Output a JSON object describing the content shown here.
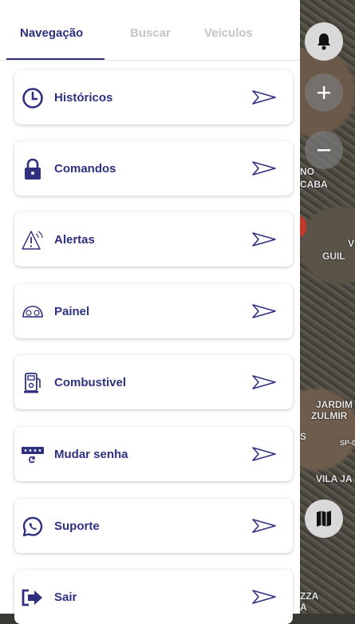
{
  "tabs": [
    {
      "label": "Navegação",
      "active": true
    },
    {
      "label": "Buscar",
      "active": false
    },
    {
      "label": "Veículos",
      "active": false
    }
  ],
  "menu": [
    {
      "label": "Históricos",
      "icon": "clock-icon"
    },
    {
      "label": "Comandos",
      "icon": "lock-icon"
    },
    {
      "label": "Alertas",
      "icon": "warning-icon"
    },
    {
      "label": "Painel",
      "icon": "dashboard-icon"
    },
    {
      "label": "Combustivel",
      "icon": "fuel-icon"
    },
    {
      "label": "Mudar senha",
      "icon": "password-icon"
    },
    {
      "label": "Suporte",
      "icon": "whatsapp-icon"
    },
    {
      "label": "Sair",
      "icon": "logout-icon"
    }
  ],
  "map": {
    "labels": [
      "NO",
      "CABA",
      "V",
      "GUIL",
      "JARDIM",
      "ZULMIR",
      "S",
      "SP-0",
      "VILA JA",
      "ZZA",
      "A"
    ]
  },
  "colors": {
    "accent": "#2f3180",
    "inactive_tab": "#c4c4cc"
  }
}
